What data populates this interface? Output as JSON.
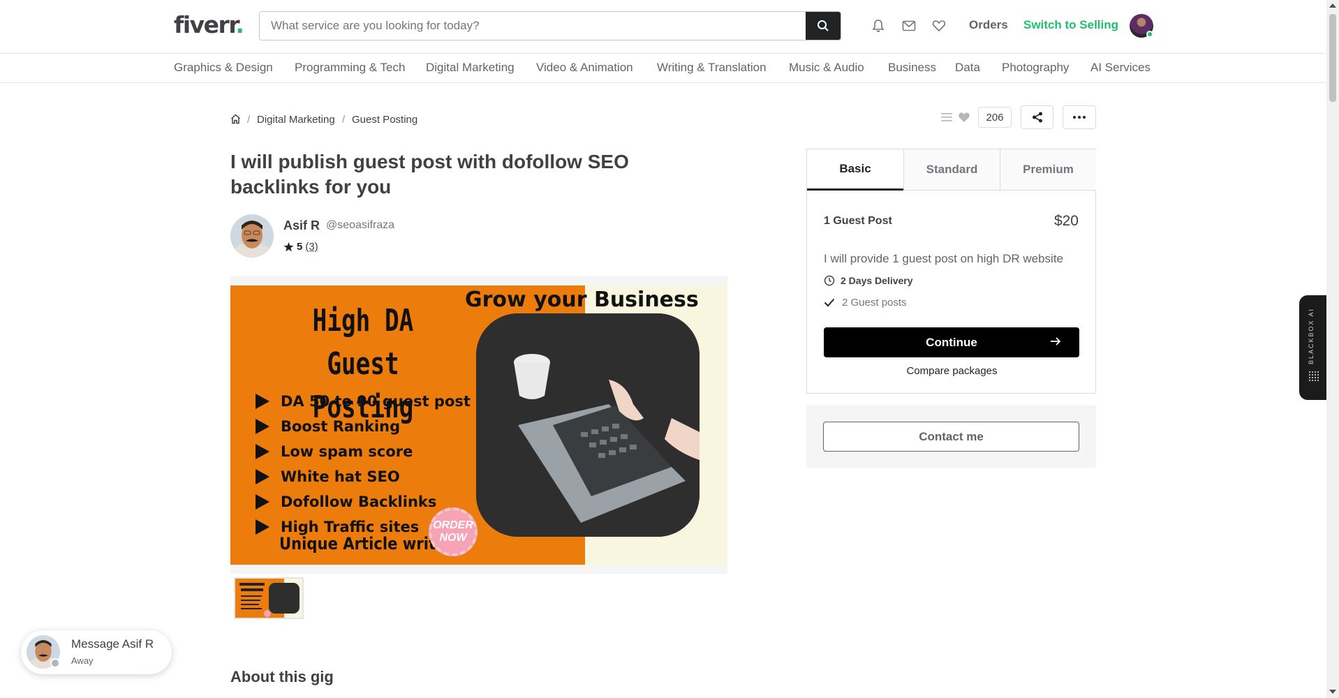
{
  "header": {
    "logo_text": "fiverr",
    "logo_dot": ".",
    "search_placeholder": "What service are you looking for today?",
    "orders_label": "Orders",
    "switch_label": "Switch to Selling"
  },
  "categories": [
    "Graphics & Design",
    "Programming & Tech",
    "Digital Marketing",
    "Video & Animation",
    "Writing & Translation",
    "Music & Audio",
    "Business",
    "Data",
    "Photography",
    "AI Services"
  ],
  "breadcrumb": {
    "items": [
      "Digital Marketing",
      "Guest Posting"
    ],
    "separator": "/"
  },
  "actions": {
    "likes_count": "206"
  },
  "gig": {
    "title": "I will publish guest post with dofollow SEO backlinks for you",
    "seller_name": "Asif R",
    "seller_handle": "@seoasifraza",
    "rating": "5",
    "rating_count": "(3)",
    "about_heading": "About this gig"
  },
  "gig_image": {
    "headline": "Grow your Business",
    "title": "High DA Guest Posting",
    "bullets": [
      "DA 50 to 90 guest post",
      "Boost Ranking",
      "Low spam score",
      "White hat SEO",
      "Dofollow Backlinks",
      "High Traffic sites"
    ],
    "footer": "Unique Article write",
    "badge": "ORDER NOW"
  },
  "package": {
    "tabs": [
      "Basic",
      "Standard",
      "Premium"
    ],
    "name": "1 Guest Post",
    "price": "$20",
    "description": "I will provide 1 guest post on high DR website",
    "delivery": "2 Days Delivery",
    "feature": "2 Guest posts",
    "continue_label": "Continue",
    "compare_label": "Compare packages",
    "contact_label": "Contact me"
  },
  "blackbox_label": "BLACKBOX AI",
  "message": {
    "name": "Message Asif R",
    "status": "Away"
  },
  "colors": {
    "brand_green": "#1dbf73",
    "text_dark": "#404145",
    "gig_orange": "#ec7c0b"
  }
}
